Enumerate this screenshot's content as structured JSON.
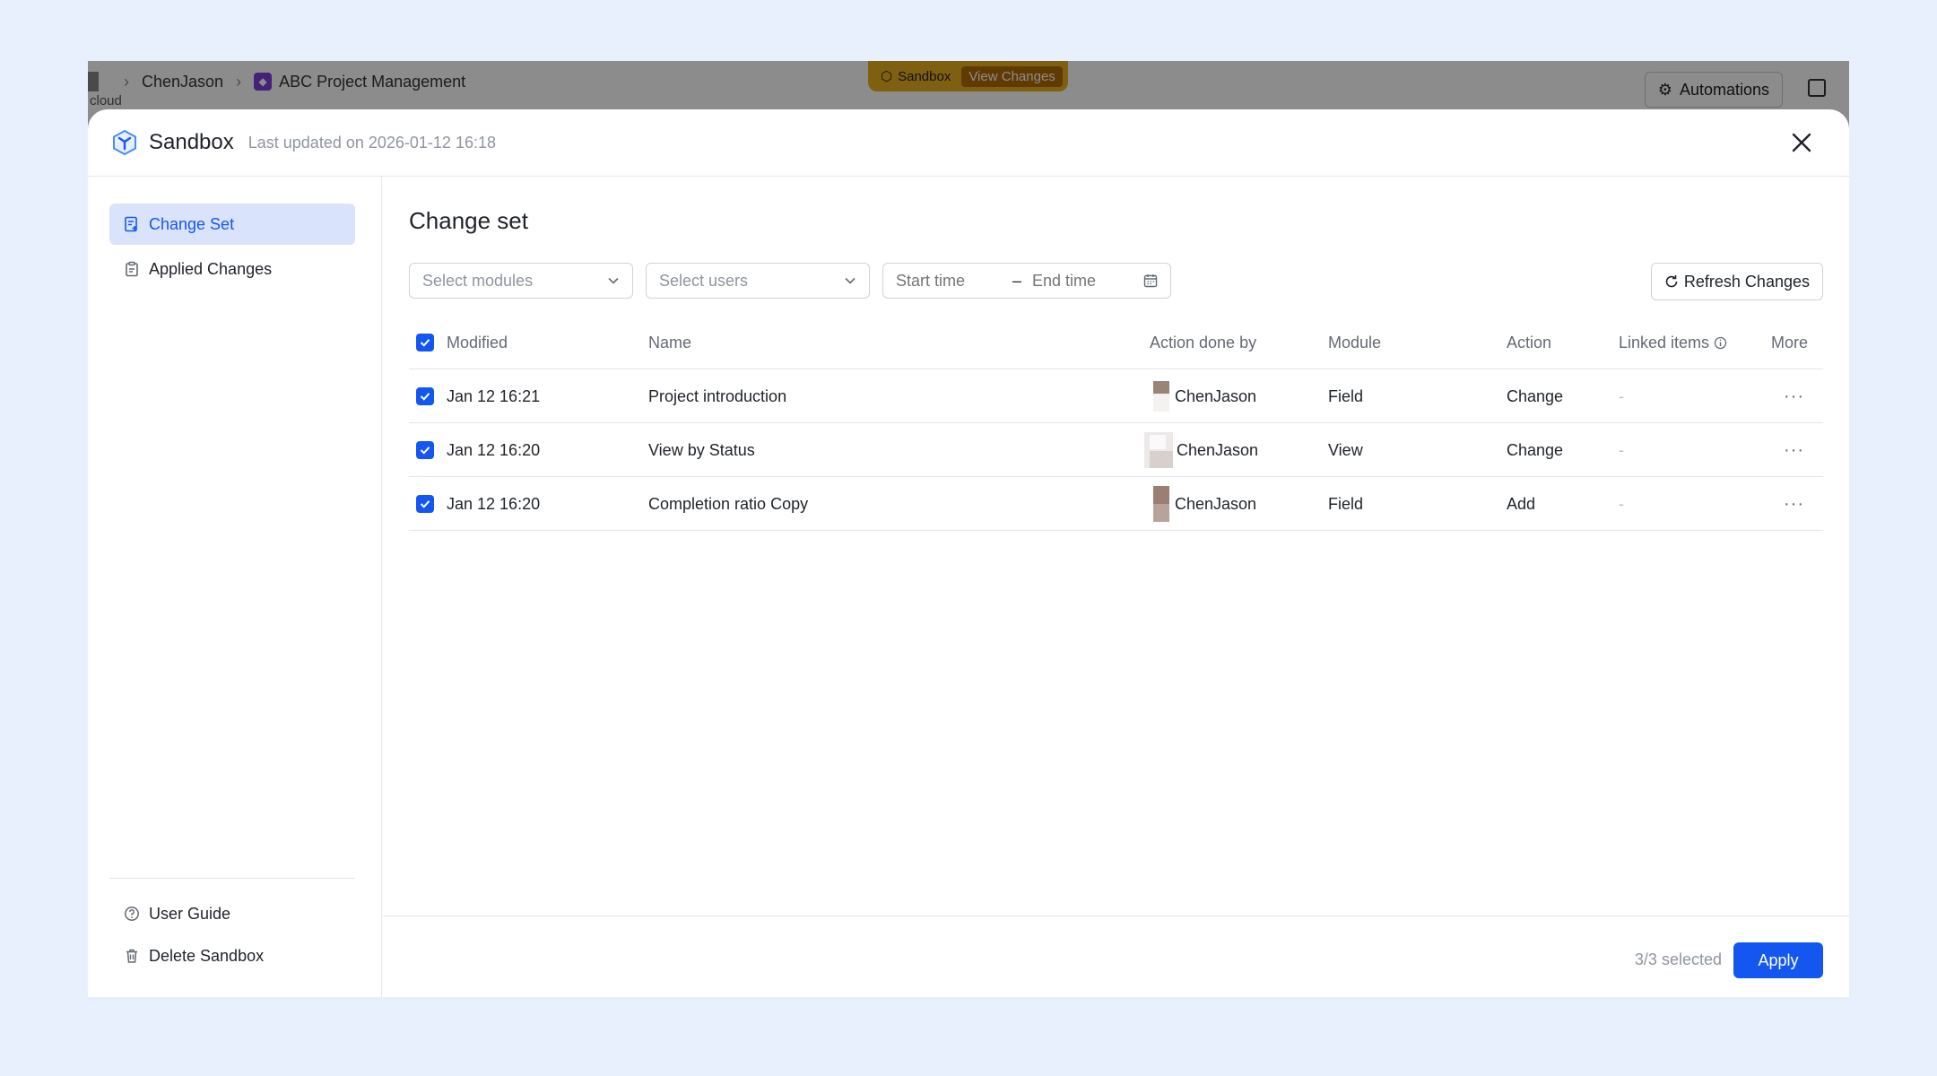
{
  "background_app": {
    "breadcrumb_user": "ChenJason",
    "project_name": "ABC Project Management",
    "cloud_label": "cloud",
    "sandbox_pill": "Sandbox",
    "view_changes": "View Changes",
    "automations": "Automations"
  },
  "modal": {
    "title": "Sandbox",
    "subtitle": "Last updated on 2026-01-12 16:18"
  },
  "sidebar": {
    "items": [
      {
        "label": "Change Set",
        "icon": "change-set-icon",
        "active": true
      },
      {
        "label": "Applied Changes",
        "icon": "clipboard-icon",
        "active": false
      }
    ],
    "bottom": [
      {
        "label": "User Guide",
        "icon": "help-circle-icon"
      },
      {
        "label": "Delete Sandbox",
        "icon": "trash-icon"
      }
    ]
  },
  "main": {
    "title": "Change set",
    "filters": {
      "modules_placeholder": "Select modules",
      "users_placeholder": "Select users",
      "start_placeholder": "Start time",
      "end_placeholder": "End time"
    },
    "refresh_label": "Refresh Changes"
  },
  "table": {
    "headers": {
      "modified": "Modified",
      "name": "Name",
      "done_by": "Action done by",
      "module": "Module",
      "action": "Action",
      "linked": "Linked items",
      "more": "More"
    },
    "rows": [
      {
        "modified": "Jan 12 16:21",
        "name": "Project introduction",
        "done_by": "ChenJason",
        "module": "Field",
        "action": "Change",
        "linked": "-",
        "more": "···"
      },
      {
        "modified": "Jan 12 16:20",
        "name": "View by Status",
        "done_by": "ChenJason",
        "module": "View",
        "action": "Change",
        "linked": "-",
        "more": "···"
      },
      {
        "modified": "Jan 12 16:20",
        "name": "Completion ratio Copy",
        "done_by": "ChenJason",
        "module": "Field",
        "action": "Add",
        "linked": "-",
        "more": "···"
      }
    ]
  },
  "footer": {
    "selected": "3/3 selected",
    "apply": "Apply"
  },
  "colors": {
    "accent": "#1456f0",
    "page_bg": "#e9f0fd",
    "active_bg": "#d9e3fb",
    "sandbox_pill": "#e8b020"
  }
}
